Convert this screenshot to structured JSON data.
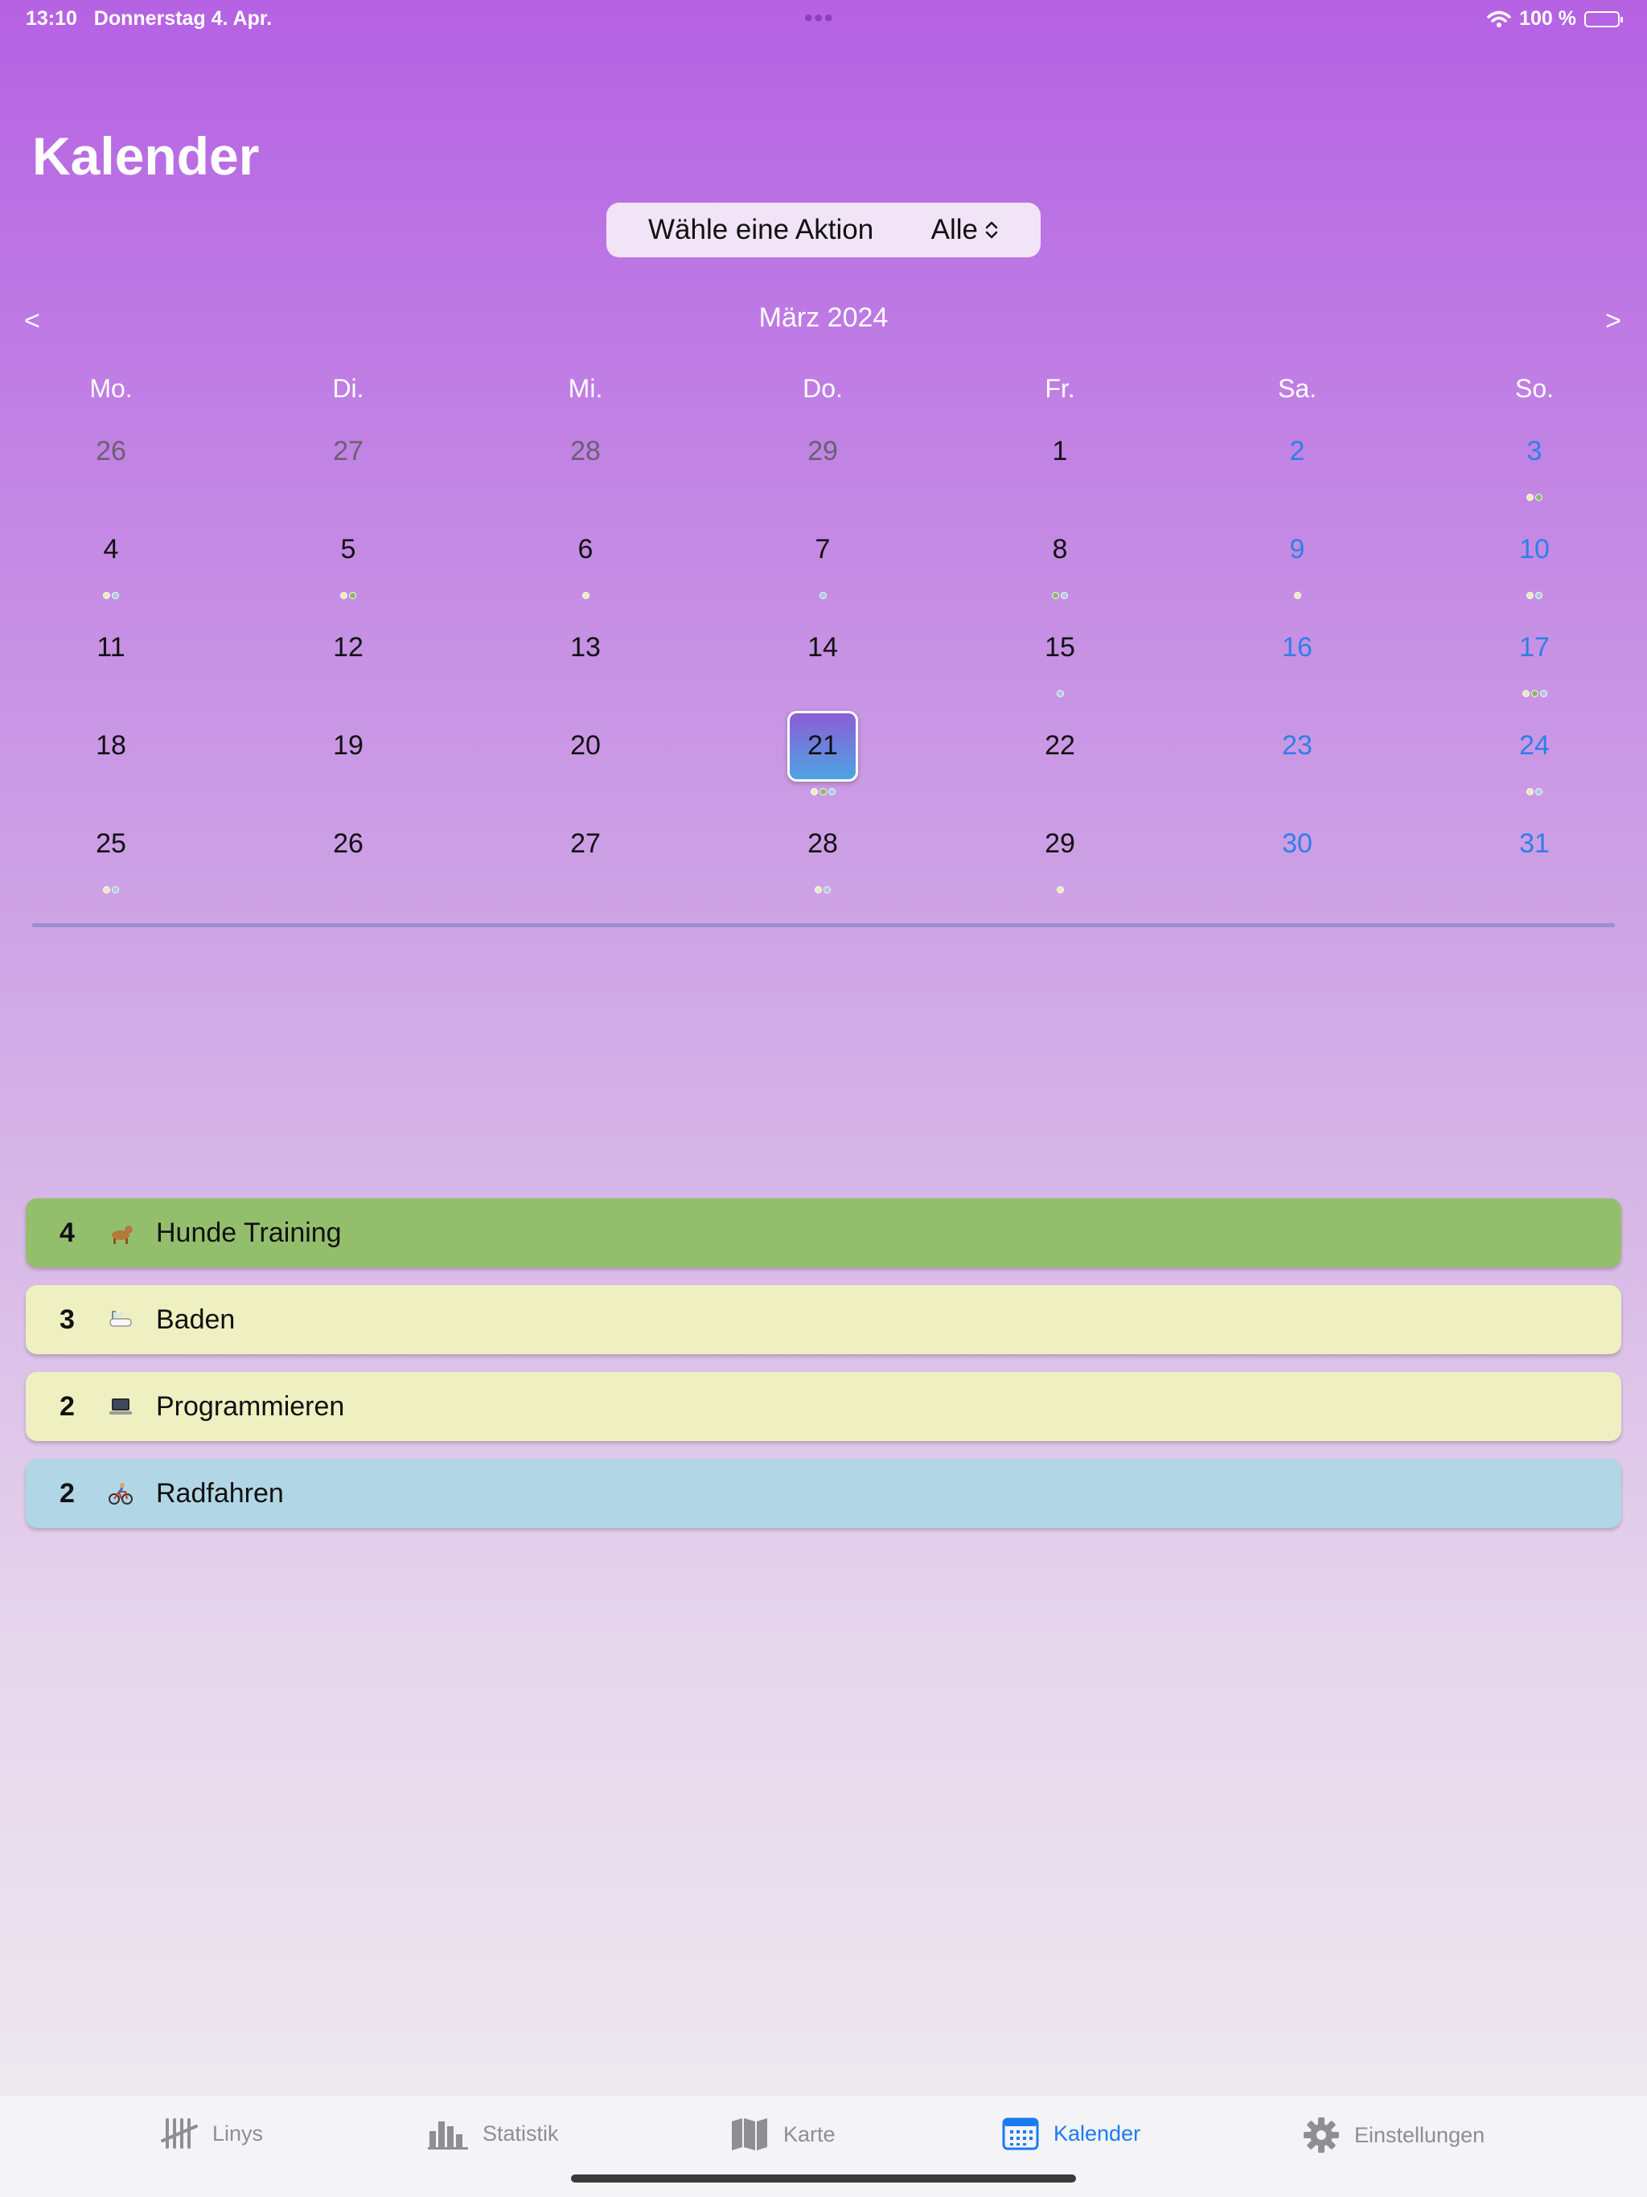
{
  "status": {
    "time": "13:10",
    "date": "Donnerstag 4. Apr.",
    "battery": "100 %"
  },
  "page_title": "Kalender",
  "action_picker": {
    "label": "Wähle eine Aktion",
    "value": "Alle"
  },
  "month_nav": {
    "prev": "<",
    "next": ">",
    "label": "März 2024"
  },
  "weekdays": [
    "Mo.",
    "Di.",
    "Mi.",
    "Do.",
    "Fr.",
    "Sa.",
    "So."
  ],
  "dot_colors": {
    "g": "#8fb86a",
    "y": "#e9ecb8",
    "b": "#a8cde0"
  },
  "calendar": {
    "selected": "21",
    "weeks": [
      [
        {
          "d": "26",
          "m": true,
          "dots": ""
        },
        {
          "d": "27",
          "m": true,
          "dots": ""
        },
        {
          "d": "28",
          "m": true,
          "dots": ""
        },
        {
          "d": "29",
          "m": true,
          "dots": ""
        },
        {
          "d": "1",
          "dots": ""
        },
        {
          "d": "2",
          "dots": ""
        },
        {
          "d": "3",
          "dots": "yg"
        }
      ],
      [
        {
          "d": "4",
          "dots": "yb"
        },
        {
          "d": "5",
          "dots": "yg"
        },
        {
          "d": "6",
          "dots": "y"
        },
        {
          "d": "7",
          "dots": "b"
        },
        {
          "d": "8",
          "dots": "gb"
        },
        {
          "d": "9",
          "dots": "y"
        },
        {
          "d": "10",
          "dots": "yb"
        }
      ],
      [
        {
          "d": "11",
          "dots": ""
        },
        {
          "d": "12",
          "dots": ""
        },
        {
          "d": "13",
          "dots": ""
        },
        {
          "d": "14",
          "dots": ""
        },
        {
          "d": "15",
          "dots": "b"
        },
        {
          "d": "16",
          "dots": ""
        },
        {
          "d": "17",
          "dots": "ygb"
        }
      ],
      [
        {
          "d": "18",
          "dots": ""
        },
        {
          "d": "19",
          "dots": ""
        },
        {
          "d": "20",
          "dots": ""
        },
        {
          "d": "21",
          "dots": "ygb"
        },
        {
          "d": "22",
          "dots": ""
        },
        {
          "d": "23",
          "dots": ""
        },
        {
          "d": "24",
          "dots": "yb"
        }
      ],
      [
        {
          "d": "25",
          "dots": "yb"
        },
        {
          "d": "26",
          "dots": ""
        },
        {
          "d": "27",
          "dots": ""
        },
        {
          "d": "28",
          "dots": "yb"
        },
        {
          "d": "29",
          "dots": "y"
        },
        {
          "d": "30",
          "dots": ""
        },
        {
          "d": "31",
          "dots": ""
        }
      ]
    ]
  },
  "activities": [
    {
      "count": "4",
      "name": "Hunde Training",
      "color": "#93bf6d",
      "icon": "dog-icon"
    },
    {
      "count": "3",
      "name": "Baden",
      "color": "#eef0c1",
      "icon": "bathtub-icon"
    },
    {
      "count": "2",
      "name": "Programmieren",
      "color": "#eef0c1",
      "icon": "laptop-icon"
    },
    {
      "count": "2",
      "name": "Radfahren",
      "color": "#b1d6e6",
      "icon": "cyclist-icon"
    }
  ],
  "tabs": [
    {
      "label": "Linys",
      "icon": "tally-icon"
    },
    {
      "label": "Statistik",
      "icon": "bar-chart-icon"
    },
    {
      "label": "Karte",
      "icon": "map-icon"
    },
    {
      "label": "Kalender",
      "icon": "calendar-icon",
      "active": true
    },
    {
      "label": "Einstellungen",
      "icon": "gear-icon"
    }
  ]
}
